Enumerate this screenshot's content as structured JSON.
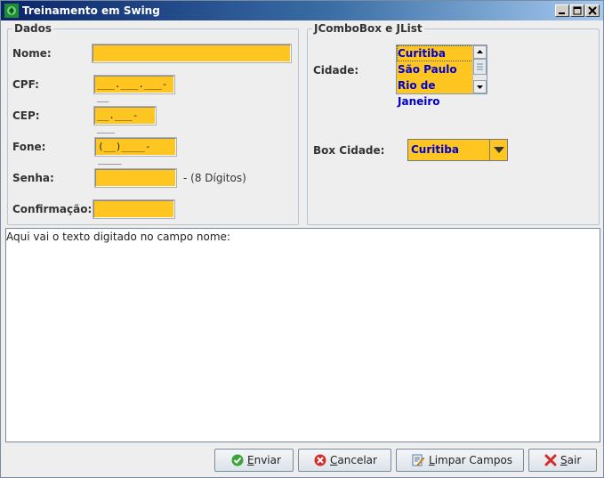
{
  "window": {
    "title": "Treinamento em Swing"
  },
  "dados": {
    "title": "Dados",
    "nome_label": "Nome:",
    "cpf_label": "CPF:",
    "cpf_value": "___.___.___-__",
    "cep_label": "CEP:",
    "cep_value": "__.___-___",
    "fone_label": "Fone:",
    "fone_value": "(__)____-____",
    "senha_label": "Senha:",
    "senha_hint": "- (8 Dígitos)",
    "confirmacao_label": "Confirmação:"
  },
  "combo_panel": {
    "title": "JComboBox e JList",
    "cidade_label": "Cidade:",
    "cidade_list": [
      "Curitiba",
      "São Paulo",
      "Rio de Janeiro"
    ],
    "box_cidade_label": "Box Cidade:",
    "box_cidade_value": "Curitiba"
  },
  "output": {
    "text": "Aqui vai o texto digitado no campo nome:"
  },
  "buttons": {
    "enviar_prefix": "E",
    "enviar_rest": "nviar",
    "cancelar_prefix": "C",
    "cancelar_rest": "ancelar",
    "limpar_prefix": "L",
    "limpar_rest": "impar Campos",
    "sair_prefix": "S",
    "sair_rest": "air"
  },
  "colors": {
    "field_bg": "#ffc622",
    "list_text": "#0000cc",
    "title_bar": "#0a246a"
  }
}
